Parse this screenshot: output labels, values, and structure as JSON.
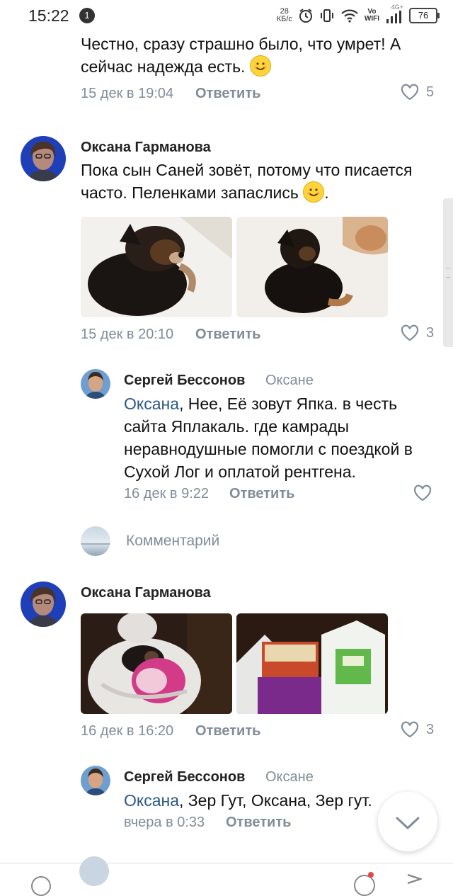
{
  "status_bar": {
    "time": "15:22",
    "notification_count": "1",
    "net_speed_value": "28",
    "net_speed_unit": "КБ/с",
    "volte_line1": "Vo",
    "volte_line2": "WIFI",
    "signal_label": "4G+",
    "battery": "76"
  },
  "comments": [
    {
      "text": "Честно, сразу страшно было, что умрет! А сейчас надежда есть.",
      "time": "15 дек в 19:04",
      "reply_label": "Ответить",
      "likes": "5"
    },
    {
      "author": "Оксана Гарманова",
      "text": "Пока сын Саней зовёт, потому что писается часто. Пеленками запаслись",
      "text_suffix": ".",
      "time": "15 дек в 20:10",
      "reply_label": "Ответить",
      "likes": "3"
    },
    {
      "author": "Сергей Бессонов",
      "reply_to": "Оксане",
      "mention": "Оксана",
      "text": ", Нее, Её зовут Япка. в честь сайта Яплакаль. где камрады неравнодушные помогли с поездкой в Сухой Лог и оплатой рентгена.",
      "time": "16 дек в 9:22",
      "reply_label": "Ответить"
    },
    {
      "author": "Оксана Гарманова",
      "time": "16 дек в 16:20",
      "reply_label": "Ответить",
      "likes": "3"
    },
    {
      "author": "Сергей Бессонов",
      "reply_to": "Оксане",
      "mention": "Оксана",
      "text": ", Зер Гут, Оксана, Зер гут.",
      "time": "вчера в 0:33",
      "reply_label": "Ответить"
    }
  ],
  "composer": {
    "placeholder": "Комментарий"
  },
  "icons": [
    "heart-icon",
    "chevron-down-icon",
    "smile-emoji-icon",
    "wifi-icon",
    "alarm-icon",
    "vibrate-icon",
    "signal-icon",
    "battery-icon"
  ],
  "colors": {
    "link": "#2a5885",
    "meta": "#818c99",
    "emoji": "#ffd43b"
  }
}
